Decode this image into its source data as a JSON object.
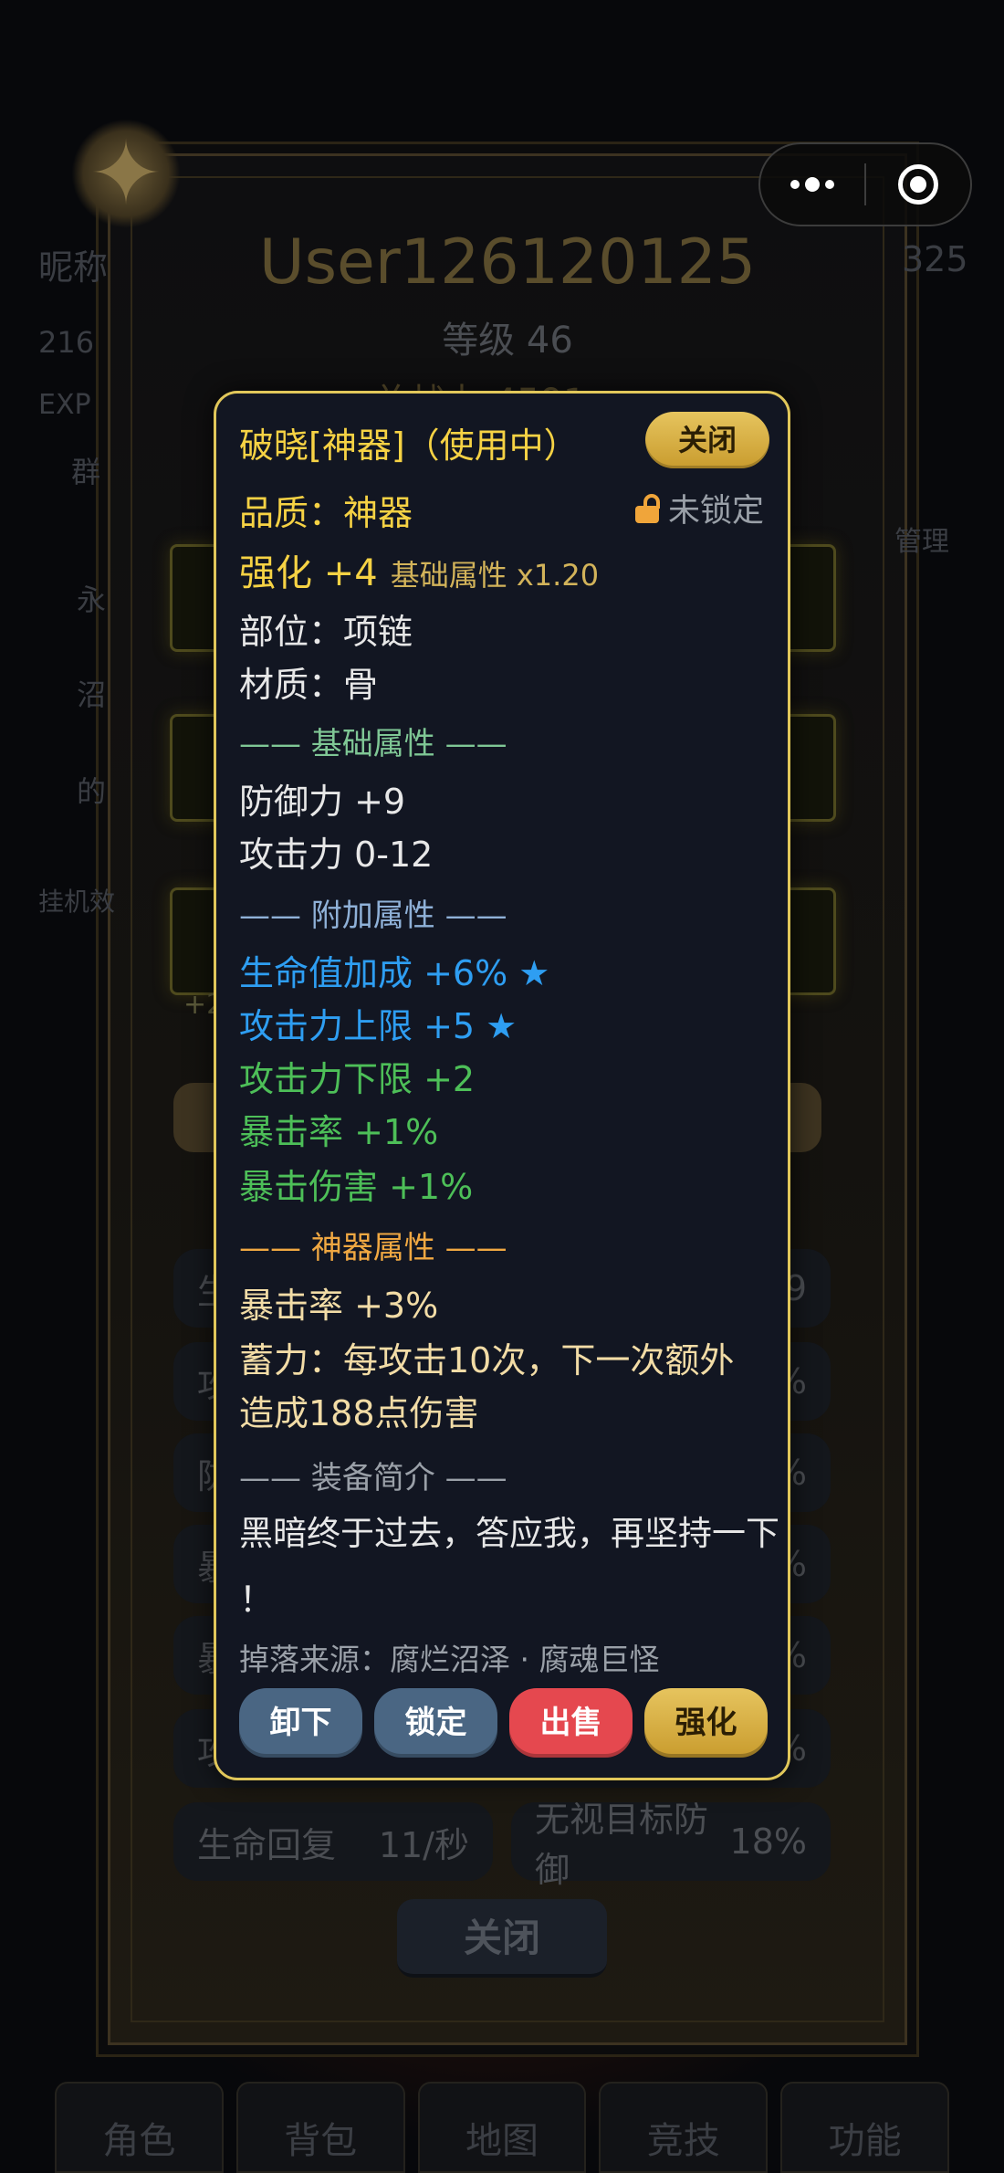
{
  "capsule": {
    "more_icon": "more-dots-icon",
    "close_icon": "target-circle-icon"
  },
  "background": {
    "username": "User126120125",
    "level": "等级 46",
    "power": "总战力 4591",
    "left_nick": "昵称",
    "left_num": "216",
    "left_exp": "EXP",
    "left_group": "群",
    "right_num": "325",
    "right_tag": "管理",
    "left_texts": [
      "永",
      "沼",
      "的"
    ],
    "idle_label": "挂机效",
    "slot_labels": [
      "+",
      "+2"
    ],
    "stats": [
      {
        "label": "生",
        "value": "9"
      },
      {
        "label": "攻",
        "value": "%"
      },
      {
        "label": "防",
        "value": "%"
      },
      {
        "label": "暴",
        "value": "%"
      },
      {
        "label": "暴",
        "value": "%"
      },
      {
        "label": "攻",
        "value": "%"
      }
    ],
    "regen_label": "生命回复",
    "regen_value": "11/秒",
    "ignore_def_label": "无视目标防御",
    "ignore_def_value": "18%",
    "close_label": "关闭",
    "nav_tabs": [
      "角色",
      "背包",
      "地图",
      "竞技",
      "功能"
    ]
  },
  "item": {
    "title": "破晓[神器]（使用中）",
    "close_label": "关闭",
    "quality": "品质：神器",
    "lock_status": "未锁定",
    "enhance": "强化 +4",
    "enhance_sub": "基础属性 x1.20",
    "slot": "部位：项链",
    "material": "材质：骨",
    "base_header": "—— 基础属性 ——",
    "base_attrs": [
      "防御力 +9",
      "攻击力 0-12"
    ],
    "extra_header": "—— 附加属性 ——",
    "extra_attrs_blue": [
      "生命值加成 +6% ★",
      "攻击力上限 +5 ★"
    ],
    "extra_attrs_green": [
      "攻击力下限 +2",
      "暴击率 +1%",
      "暴击伤害 +1%"
    ],
    "artifact_header": "—— 神器属性 ——",
    "artifact_attr": "暴击率 +3%",
    "artifact_skill_line1": "蓄力：每攻击10次，下一次额外",
    "artifact_skill_line2": "造成188点伤害",
    "desc_header": "—— 装备简介 ——",
    "desc_line1": "黑暗终于过去，答应我，再坚持一下",
    "desc_line2": "！",
    "drop_source": "掉落来源：腐烂沼泽 · 腐魂巨怪"
  },
  "actions": {
    "unequip": "卸下",
    "lock": "锁定",
    "sell": "出售",
    "enhance": "强化"
  },
  "colors": {
    "border_gold": "#e1c75a",
    "sell_red": "#e5484f",
    "blue_rare": "#2e9ef2",
    "green_attr": "#4dbf58"
  }
}
